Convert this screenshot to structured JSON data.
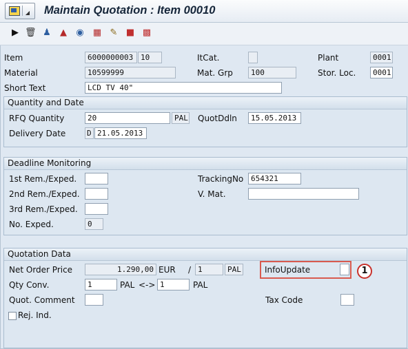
{
  "window": {
    "title": "Maintain Quotation : Item 00010"
  },
  "toolbar": {
    "icons": [
      "play-icon",
      "trash-icon",
      "person-icon",
      "hat-icon",
      "glasses-icon",
      "grid-icon",
      "edit-icon",
      "truck-icon",
      "calendar-icon"
    ]
  },
  "header": {
    "item_label": "Item",
    "item_number": "6000000003",
    "item_pos": "10",
    "itcat_label": "ItCat.",
    "itcat_value": "",
    "plant_label": "Plant",
    "plant_value": "0001",
    "material_label": "Material",
    "material_value": "10599999",
    "matgrp_label": "Mat. Grp",
    "matgrp_value": "100",
    "storloc_label": "Stor. Loc.",
    "storloc_value": "0001",
    "shorttext_label": "Short Text",
    "shorttext_value": "LCD TV 40\""
  },
  "qty_date": {
    "title": "Quantity and Date",
    "rfq_label": "RFQ Quantity",
    "rfq_value": "20",
    "rfq_unit": "PAL",
    "quotddln_label": "QuotDdln",
    "quotddln_value": "15.05.2013",
    "delivery_label": "Delivery Date",
    "delivery_cat": "D",
    "delivery_value": "21.05.2013"
  },
  "deadline": {
    "title": "Deadline Monitoring",
    "rem1_label": "1st Rem./Exped.",
    "rem1_value": "",
    "rem2_label": "2nd Rem./Exped.",
    "rem2_value": "",
    "rem3_label": "3rd Rem./Exped.",
    "rem3_value": "",
    "noexped_label": "No. Exped.",
    "noexped_value": "0",
    "tracking_label": "TrackingNo",
    "tracking_value": "654321",
    "vmat_label": "V. Mat.",
    "vmat_value": ""
  },
  "quotation": {
    "title": "Quotation Data",
    "netprice_label": "Net Order Price",
    "netprice_value": "1.290,00",
    "currency": "EUR",
    "per_sep": "/",
    "per_value": "1",
    "per_unit": "PAL",
    "infoupdate_label": "InfoUpdate",
    "infoupdate_value": "",
    "qtyconv_label": "Qty Conv.",
    "qtyconv_num": "1",
    "qtyconv_unit1": "PAL",
    "qtyconv_arrow": "<->",
    "qtyconv_den": "1",
    "qtyconv_unit2": "PAL",
    "comment_label": "Quot. Comment",
    "comment_value": "",
    "taxcode_label": "Tax Code",
    "taxcode_value": "",
    "rejind_label": "Rej. Ind."
  },
  "annotation": {
    "callout_number": "1",
    "highlight_color": "#d85a4f",
    "callout_color": "#c8312b"
  }
}
